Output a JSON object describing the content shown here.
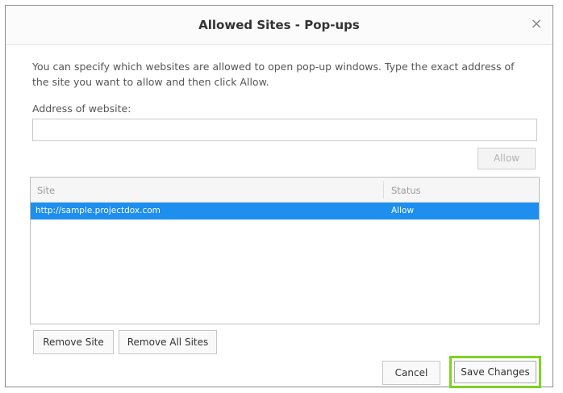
{
  "dialog": {
    "title": "Allowed Sites - Pop-ups",
    "close_icon": "×"
  },
  "description": "You can specify which websites are allowed to open pop-up windows. Type the exact address of the site you want to allow and then click Allow.",
  "address": {
    "label": "Address of website:",
    "value": "",
    "placeholder": ""
  },
  "buttons": {
    "allow": "Allow",
    "remove_site": "Remove Site",
    "remove_all_sites": "Remove All Sites",
    "cancel": "Cancel",
    "save_changes": "Save Changes"
  },
  "table": {
    "columns": [
      "Site",
      "Status"
    ],
    "rows": [
      {
        "site": "http://sample.projectdox.com",
        "status": "Allow",
        "selected": true
      }
    ]
  },
  "colors": {
    "selection": "#1e8eef",
    "highlight_outline": "#7dd323"
  }
}
